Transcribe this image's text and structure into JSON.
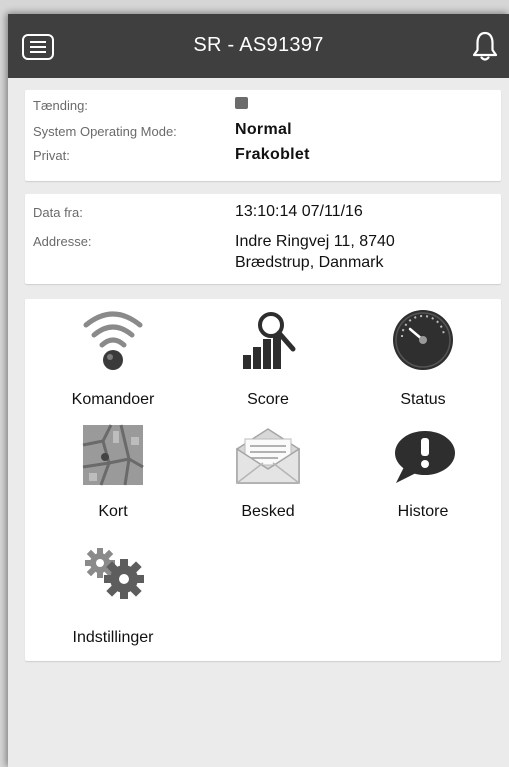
{
  "header": {
    "title": "SR - AS91397",
    "menu_icon": "menu-icon",
    "bell_icon": "bell-icon"
  },
  "status_card": {
    "ignition_label": "Tænding:",
    "ignition_color": "#6b6b6b",
    "mode_label": "System Operating Mode:",
    "mode_value": "Normal",
    "private_label": "Privat:",
    "private_value": "Frakoblet"
  },
  "location_card": {
    "data_label": "Data fra:",
    "data_value": "13:10:14 07/11/16",
    "address_label": "Addresse:",
    "address_line1": "Indre Ringvej 11, 8740",
    "address_line2": "Brædstrup, Danmark"
  },
  "menu": {
    "items": [
      {
        "label": "Komandoer",
        "icon": "wifi-signal-icon"
      },
      {
        "label": "Score",
        "icon": "score-chart-icon"
      },
      {
        "label": "Status",
        "icon": "gauge-icon"
      },
      {
        "label": "Kort",
        "icon": "map-icon"
      },
      {
        "label": "Besked",
        "icon": "envelope-icon"
      },
      {
        "label": "Histore",
        "icon": "alert-bubble-icon"
      },
      {
        "label": "Indstillinger",
        "icon": "gears-icon"
      }
    ]
  }
}
